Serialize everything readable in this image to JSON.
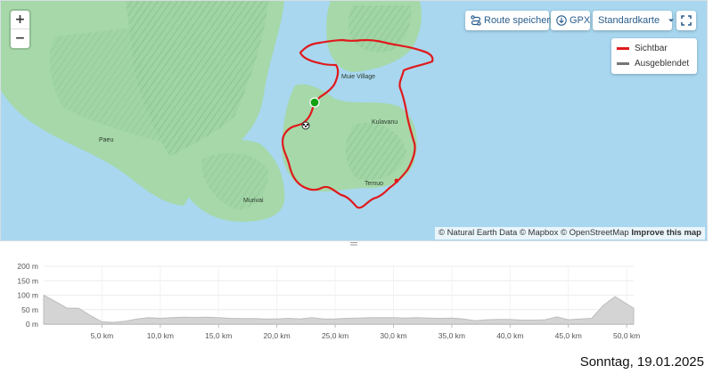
{
  "map": {
    "zoom_in_label": "+",
    "zoom_out_label": "−",
    "toolbar": {
      "save_route_label": "Route speichern",
      "gpx_label": "GPX",
      "map_style_label": "Standardkarte"
    },
    "legend": {
      "visible_label": "Sichtbar",
      "hidden_label": "Ausgeblendet",
      "visible_color": "#e0191c",
      "hidden_color": "#777777"
    },
    "places": {
      "muie_village": "Muie Village",
      "paeu": "Paeu",
      "kulavanu": "Kulavanu",
      "temuo": "Temuo",
      "murivai": "Murivai"
    },
    "attribution": {
      "text": "© Natural Earth Data © Mapbox © OpenStreetMap",
      "improve_label": "Improve this map"
    },
    "colors": {
      "water": "#a8d7ef",
      "land": "#9fd3a4",
      "route": "#e0191c",
      "start": "#12a112"
    }
  },
  "elevation": {
    "y_tick_labels": [
      "200 m",
      "150 m",
      "100 m",
      "50 m",
      "0 m"
    ],
    "x_tick_labels": [
      "5,0 km",
      "10,0 km",
      "15,0 km",
      "20,0 km",
      "25,0 km",
      "30,0 km",
      "35,0 km",
      "40,0 km",
      "45,0 km",
      "50,0 km"
    ]
  },
  "footer": {
    "date_label": "Sonntag, 19.01.2025"
  },
  "chart_data": {
    "type": "area",
    "xlabel": "",
    "ylabel": "",
    "xlim": [
      0,
      50.6
    ],
    "ylim": [
      0,
      200
    ],
    "x_ticks": [
      5,
      10,
      15,
      20,
      25,
      30,
      35,
      40,
      45,
      50
    ],
    "y_ticks": [
      0,
      50,
      100,
      150,
      200
    ],
    "series": [
      {
        "x": [
          0,
          1,
          2,
          3,
          4,
          5,
          6,
          7,
          8,
          9,
          10,
          11,
          12,
          13,
          14,
          15,
          16,
          17,
          18,
          19,
          20,
          21,
          22,
          23,
          24,
          25,
          26,
          27,
          28,
          29,
          30,
          31,
          32,
          33,
          34,
          35,
          36,
          37,
          38,
          39,
          40,
          41,
          42,
          43,
          44,
          45,
          46,
          47,
          48,
          49,
          50,
          50.6
        ],
        "values": [
          100,
          78,
          55,
          55,
          30,
          8,
          6,
          10,
          18,
          22,
          20,
          22,
          24,
          23,
          24,
          22,
          20,
          19,
          19,
          18,
          18,
          20,
          18,
          22,
          18,
          18,
          20,
          21,
          22,
          22,
          22,
          21,
          22,
          21,
          20,
          21,
          18,
          12,
          15,
          16,
          16,
          14,
          14,
          15,
          25,
          15,
          18,
          20,
          65,
          95,
          70,
          55
        ]
      }
    ]
  }
}
